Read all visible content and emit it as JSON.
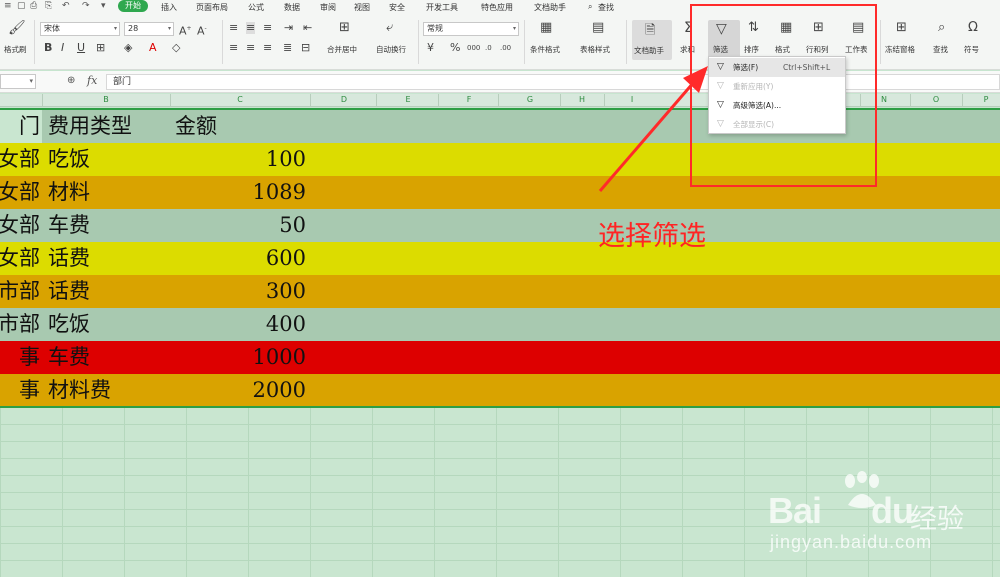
{
  "menubar": {
    "quick_icons": [
      "≡",
      "▢",
      "⎙",
      "⎘",
      "↶",
      "↷",
      "▾"
    ],
    "tabs": [
      {
        "label": "开始",
        "active": true
      },
      {
        "label": "插入"
      },
      {
        "label": "页面布局"
      },
      {
        "label": "公式"
      },
      {
        "label": "数据"
      },
      {
        "label": "审阅"
      },
      {
        "label": "视图"
      },
      {
        "label": "安全"
      },
      {
        "label": "开发工具"
      },
      {
        "label": "特色应用"
      },
      {
        "label": "文档助手"
      },
      {
        "label": "查找"
      }
    ]
  },
  "ribbon": {
    "format_painter": "格式刷",
    "font_name": "宋体",
    "font_size": "28",
    "merge_center": "合并居中",
    "wrap_text": "自动换行",
    "number_format": "常规",
    "conditional_format": "条件格式",
    "table_style": "表格样式",
    "doc_helper": "文档助手",
    "sum": "求和",
    "filter": "筛选",
    "sort": "排序",
    "format": "格式",
    "rows_cols": "行和列",
    "worksheet": "工作表",
    "freeze": "冻结窗格",
    "find": "查找",
    "symbol": "符号"
  },
  "formula_bar": {
    "fx": "fx",
    "content": "部门"
  },
  "columns": [
    "B",
    "C",
    "D",
    "E",
    "F",
    "G",
    "H",
    "I",
    "N",
    "O",
    "P"
  ],
  "table": {
    "header": {
      "a": "门",
      "b": "费用类型",
      "c": "金额",
      "color": "#a8c9b0"
    },
    "rows": [
      {
        "a": "女部",
        "b": "吃饭",
        "c": "100",
        "color": "#dcdc00",
        "text_color": "#111111"
      },
      {
        "a": "女部",
        "b": "材料",
        "c": "1089",
        "color": "#d9a300",
        "text_color": "#111111"
      },
      {
        "a": "女部",
        "b": "车费",
        "c": "50",
        "color": "#a8c9b0",
        "text_color": "#111111"
      },
      {
        "a": "女部",
        "b": "话费",
        "c": "600",
        "color": "#dcdc00",
        "text_color": "#111111"
      },
      {
        "a": "市部",
        "b": "话费",
        "c": "300",
        "color": "#d9a300",
        "text_color": "#111111"
      },
      {
        "a": "市部",
        "b": "吃饭",
        "c": "400",
        "color": "#a8c9b0",
        "text_color": "#111111"
      },
      {
        "a": "事",
        "b": "车费",
        "c": "1000",
        "color": "#dd0000",
        "text_color": "#111111"
      },
      {
        "a": "事",
        "b": "材料费",
        "c": "2000",
        "color": "#d9a300",
        "text_color": "#111111"
      }
    ]
  },
  "dropdown": {
    "items": [
      {
        "label": "筛选(F)",
        "shortcut": "Ctrl+Shift+L",
        "enabled": true
      },
      {
        "label": "重新应用(Y)",
        "shortcut": "",
        "enabled": false
      },
      {
        "label": "高级筛选(A)...",
        "shortcut": "",
        "enabled": true
      },
      {
        "label": "全部显示(C)",
        "shortcut": "",
        "enabled": false
      }
    ]
  },
  "annotation": {
    "text": "选择筛选",
    "color": "#ff2424"
  },
  "watermark": {
    "brand_latin": "Bai",
    "brand_latin2": "du",
    "brand_cn": "经验",
    "url": "jingyan.baidu.com"
  }
}
